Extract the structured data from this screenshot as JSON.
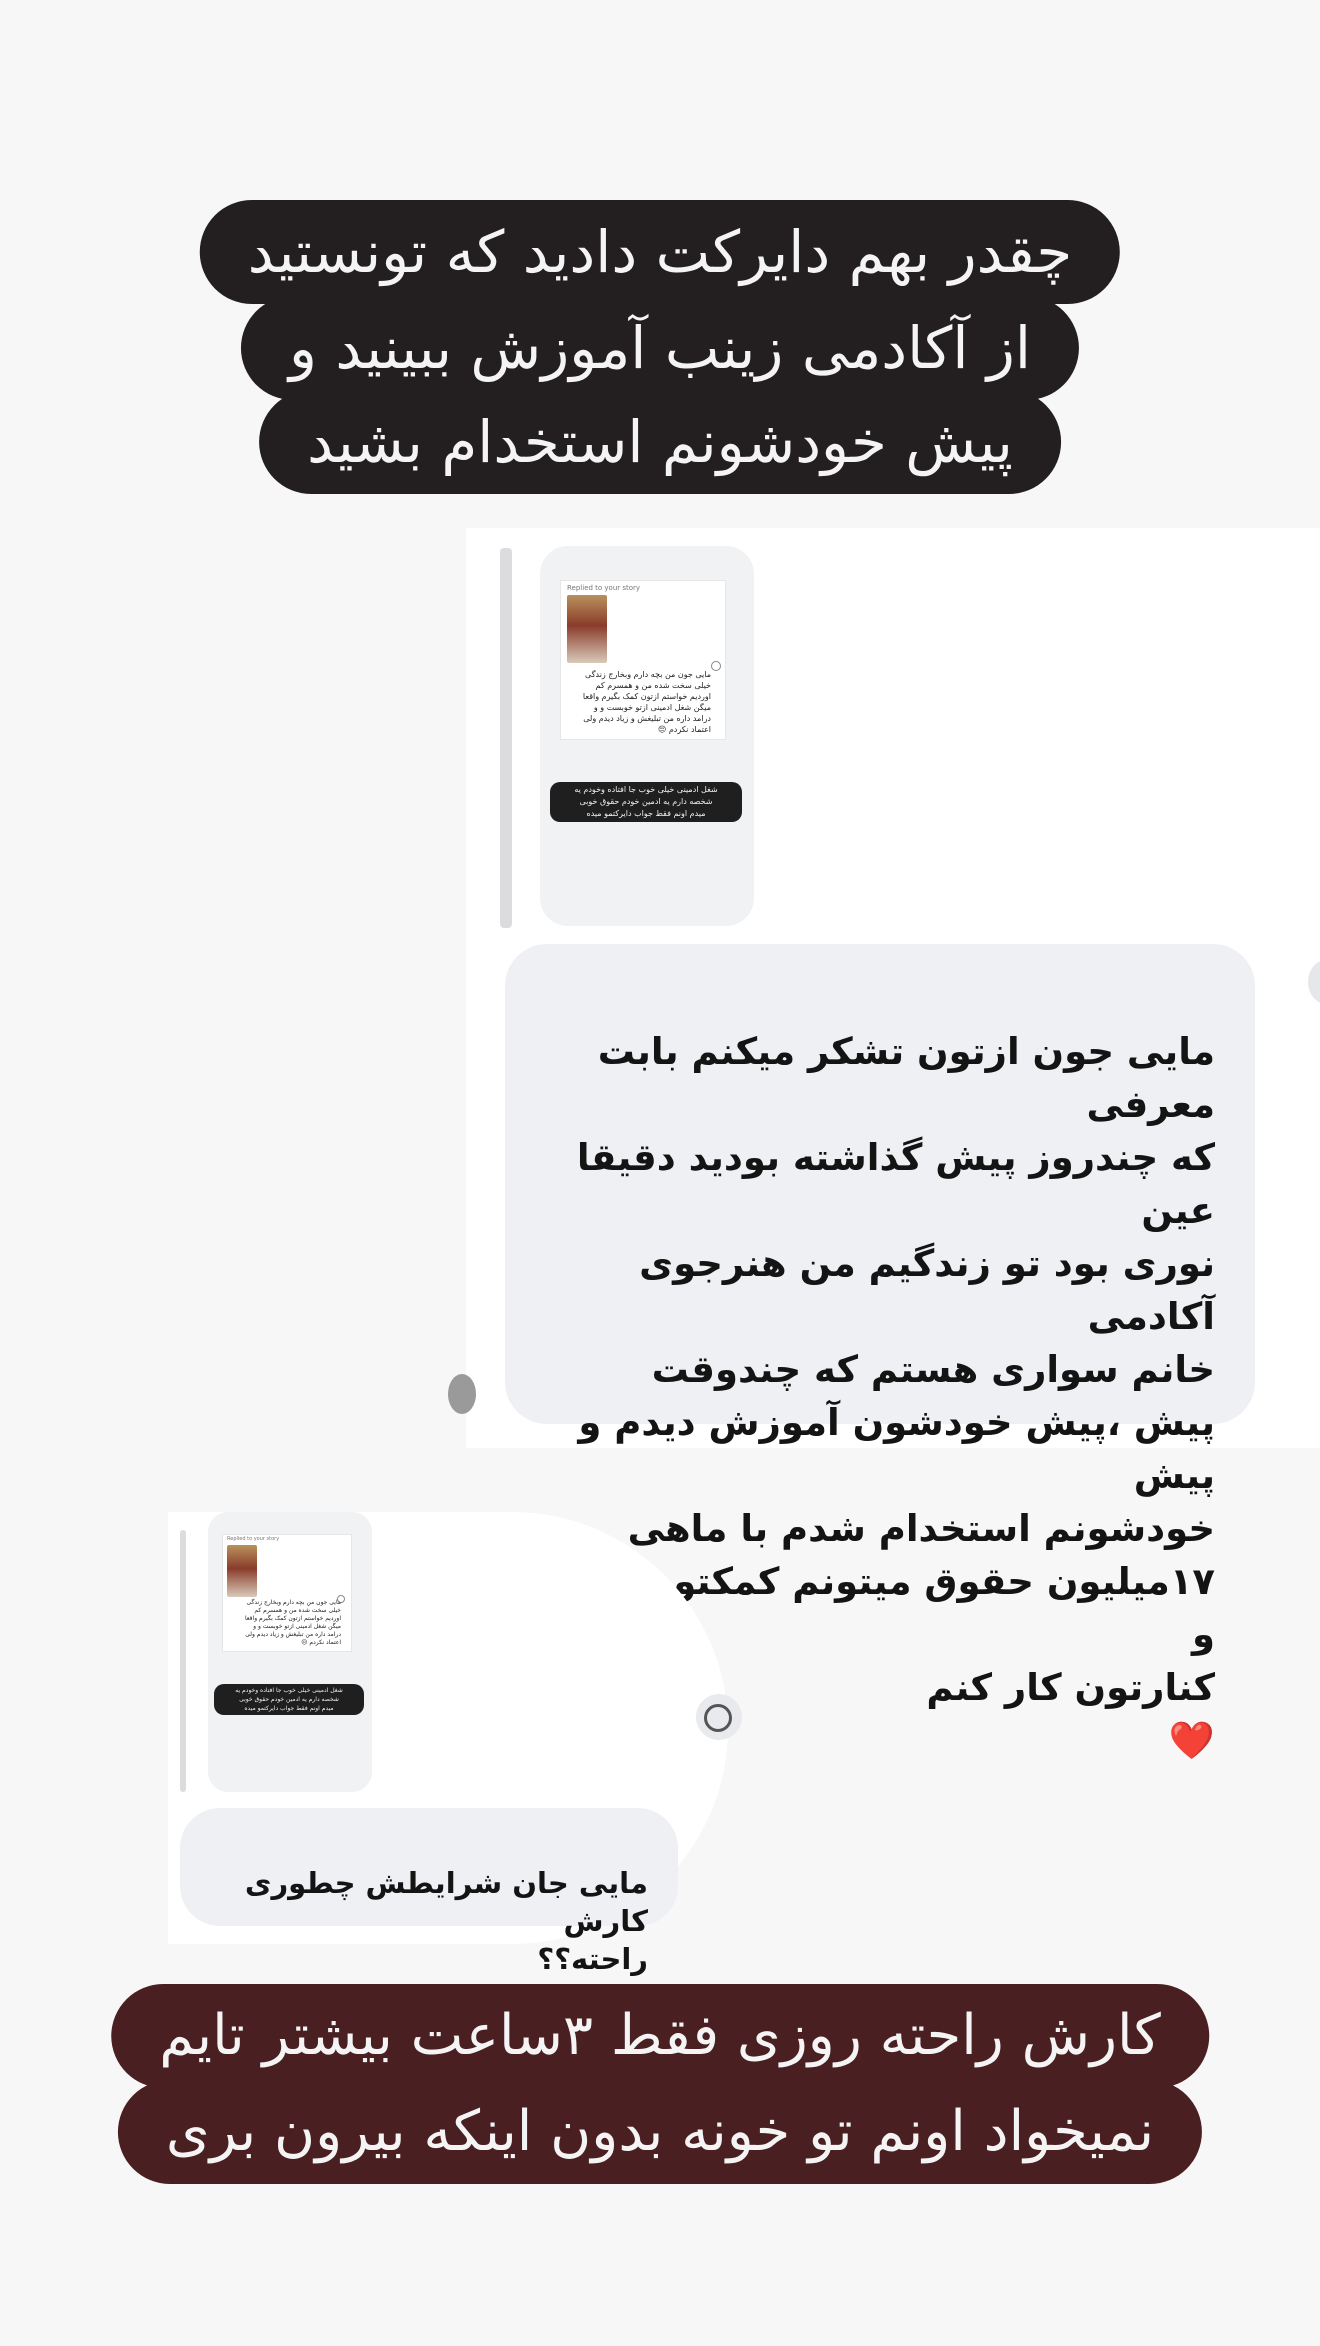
{
  "caption_top": {
    "lines": [
      "چقدر بهم دایرکت دادید که تونستید",
      "از آکادمی زینب آموزش ببینید و",
      "پیش خودشونم استخدام بشید"
    ]
  },
  "story_reply": {
    "header": "Replied to your story",
    "text": "مایی جون من بچه دارم وبخارج زندگی\nخیلی سخت شده من و همسرم کم\nاوردیم خواستم ازتون کمک بگیرم واقعا\nمیگن شغل ادمینی ازتو خوبست و و\nدرامد داره من تبلیغش و زیاد دیدم ولی\nاعتماد نکردم 😔",
    "reply_pill": "شغل ادمینی خیلی خوب جا افتاده وخودم یه\nشخصه دارم یه ادمین خودم حقوق خوبی\nمیدم اونم فقط جواب دایرکتمو میده"
  },
  "message_1": {
    "text": "مایی جون ازتون تشکر میکنم بابت معرفی\nکه چندروز پیش گذاشته بودید دقیقا عین\nنوری بود تو زندگیم من هنرجوی آکادمی\nخانم سواری هستم که چندوقت\nپیش ،پیش خودشون آموزش دیدم و پیش\nخودشونم استخدام شدم با ماهی\n۱۷میلیون حقوق میتونم کمکتون کنم و\nکنارتون کار کنم",
    "emoji": "❤️"
  },
  "message_2": {
    "text": "مایی جان شرایطش چطوری کارش\nراحته؟؟"
  },
  "caption_bottom": {
    "lines": [
      "کارش راحته روزی فقط ۳ساعت بیشتر تایم",
      "نمیخواد اونم تو خونه بدون اینکه بیرون بری"
    ]
  },
  "colors": {
    "caption_top_bg": "#231f20",
    "caption_bottom_bg": "#4a1f22",
    "bubble_bg": "#eef0f3",
    "page_bg": "#f7f7f8"
  },
  "icons": [
    "react-icon",
    "heart-emoji"
  ]
}
